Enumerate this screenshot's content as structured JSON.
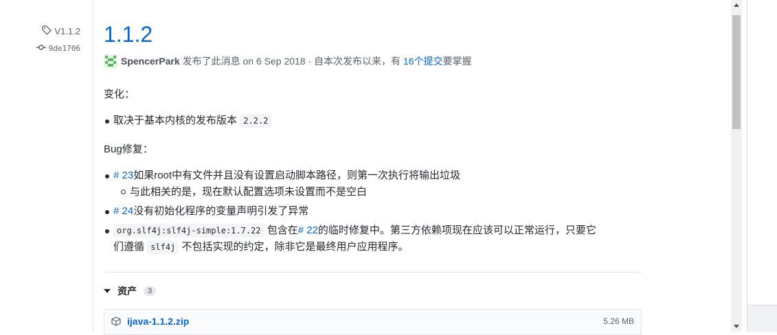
{
  "sidebar": {
    "tag": "V1.1.2",
    "commit": "9de1706",
    "tag_icon": "tag-icon",
    "commit_icon": "git-commit-icon"
  },
  "release": {
    "title": "1.1.2",
    "author": "SpencerPark",
    "published_text": "发布了此消息",
    "date_text": "on 6 Sep 2018",
    "since_text": "· 自本次发布以来，有",
    "commits_link": "16个提交",
    "commits_suffix": "要掌握"
  },
  "notes": {
    "changes_label": "变化：",
    "change_item_text": "取决于基本内核的发布版本",
    "change_item_code": "2.2.2",
    "bugfix_label": "Bug修复：",
    "bug1_link": "# 23",
    "bug1_text": "如果root中有文件并且没有设置启动脚本路径，则第一次执行将输出垃圾",
    "bug1_sub": "与此相关的是，现在默认配置选项未设置而不是空白",
    "bug2_link": "# 24",
    "bug2_text": "没有初始化程序的变量声明引发了异常",
    "bug3_code": "org.slf4j:slf4j-simple:1.7.22",
    "bug3_text_a": "包含在",
    "bug3_link": "# 22",
    "bug3_text_b": "的临时修复中。第三方依赖项现在应该可以正常运行，只要它",
    "bug3_text_c": "们遵循",
    "bug3_code2": "slf4j",
    "bug3_text_d": "不包括实现的约定，除非它是最终用户应用程序。"
  },
  "assets": {
    "label": "资产",
    "count": "3",
    "items": [
      {
        "name": "ijava-1.1.2.zip",
        "size": "5.26 MB",
        "icon": "package-icon"
      }
    ]
  },
  "colors": {
    "link": "#0366d6",
    "text": "#24292e",
    "muted": "#586069"
  }
}
